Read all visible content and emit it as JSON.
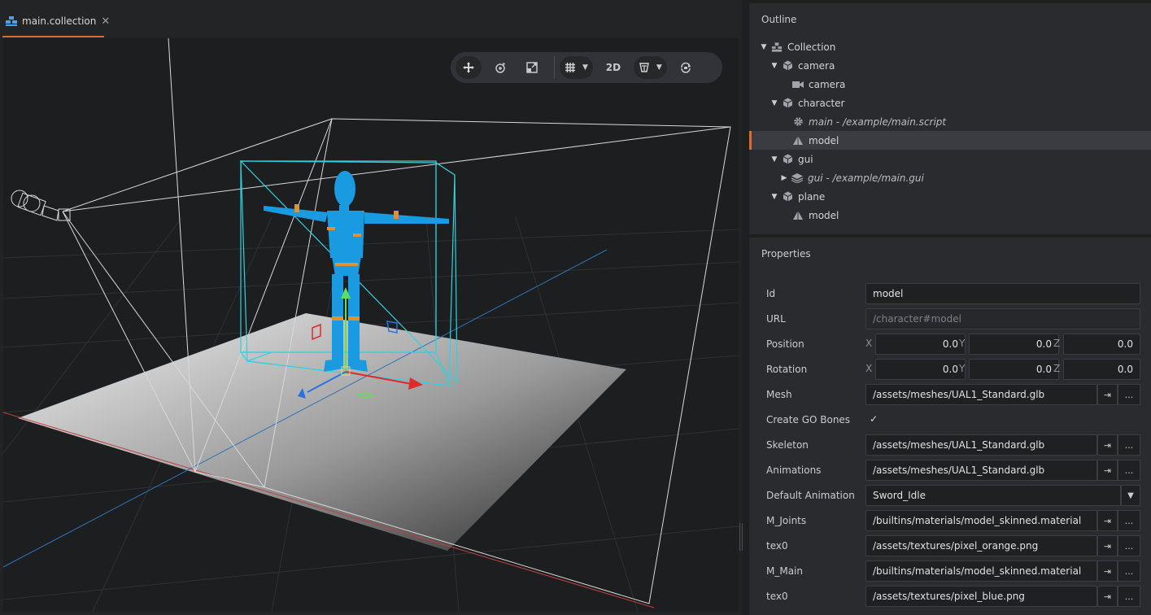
{
  "tab": {
    "label": "main.collection",
    "close": "✕"
  },
  "toolbar": {
    "mode_2d": "2D"
  },
  "outline": {
    "title": "Outline",
    "items": [
      {
        "label": "Collection",
        "icon": "collection-icon",
        "arrow": "▼"
      },
      {
        "label": "camera",
        "icon": "gameobject-icon",
        "arrow": "▼"
      },
      {
        "label": "camera",
        "icon": "camera-icon",
        "arrow": ""
      },
      {
        "label": "character",
        "icon": "gameobject-icon",
        "arrow": "▼"
      },
      {
        "label": "main - /example/main.script",
        "icon": "gear-icon",
        "arrow": ""
      },
      {
        "label": "model",
        "icon": "model-icon",
        "arrow": "",
        "selected": true
      },
      {
        "label": "gui",
        "icon": "gameobject-icon",
        "arrow": "▼"
      },
      {
        "label": "gui - /example/main.gui",
        "icon": "gui-icon",
        "arrow": "▶"
      },
      {
        "label": "plane",
        "icon": "gameobject-icon",
        "arrow": "▼"
      },
      {
        "label": "model",
        "icon": "model-icon",
        "arrow": ""
      }
    ]
  },
  "properties": {
    "title": "Properties",
    "id": {
      "label": "Id",
      "value": "model"
    },
    "url": {
      "label": "URL",
      "value": "/character#model"
    },
    "position": {
      "label": "Position",
      "x": "0.0",
      "y": "0.0",
      "z": "0.0"
    },
    "rotation": {
      "label": "Rotation",
      "x": "0.0",
      "y": "0.0",
      "z": "0.0"
    },
    "axes": {
      "x": "X",
      "y": "Y",
      "z": "Z"
    },
    "mesh": {
      "label": "Mesh",
      "value": "/assets/meshes/UAL1_Standard.glb"
    },
    "create_go_bones": {
      "label": "Create GO Bones",
      "checked": "✓"
    },
    "skeleton": {
      "label": "Skeleton",
      "value": "/assets/meshes/UAL1_Standard.glb"
    },
    "animations": {
      "label": "Animations",
      "value": "/assets/meshes/UAL1_Standard.glb"
    },
    "default_animation": {
      "label": "Default Animation",
      "value": "Sword_Idle"
    },
    "m_joints": {
      "label": "M_Joints",
      "value": "/builtins/materials/model_skinned.material"
    },
    "tex0_a": {
      "label": "tex0",
      "value": "/assets/textures/pixel_orange.png"
    },
    "m_main": {
      "label": "M_Main",
      "value": "/builtins/materials/model_skinned.material"
    },
    "tex0_b": {
      "label": "tex0",
      "value": "/assets/textures/pixel_blue.png"
    },
    "browse_label": "...",
    "open_label": "⇥"
  },
  "colors": {
    "accent": "#e0692f",
    "selection_box": "#2fd3df",
    "character": "#1a9ae0",
    "joints": "#e0912f"
  }
}
